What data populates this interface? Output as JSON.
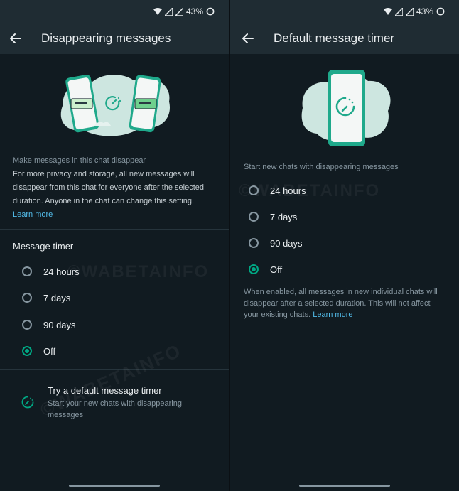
{
  "status": {
    "battery": "43%"
  },
  "colors": {
    "accent": "#00a884",
    "link": "#53bdeb",
    "surface": "#1f2c33",
    "background": "#111b21"
  },
  "left": {
    "title": "Disappearing messages",
    "intro_heading": "Make messages in this chat disappear",
    "intro_lines": [
      "For more privacy and storage, all new messages will",
      "disappear from this chat for everyone after the selected",
      "duration. Anyone in the chat can change this setting."
    ],
    "learn_more": "Learn more",
    "timer_title": "Message timer",
    "options": [
      "24 hours",
      "7 days",
      "90 days",
      "Off"
    ],
    "selected_option": "Off",
    "try_title": "Try a default message timer",
    "try_subtitle_lines": [
      "Start your new chats with disappearing",
      "messages"
    ],
    "watermark": "©WABETAINFO"
  },
  "right": {
    "title": "Default message timer",
    "heading": "Start new chats with disappearing messages",
    "options": [
      "24 hours",
      "7 days",
      "90 days",
      "Off"
    ],
    "selected_option": "Off",
    "footer_lines": [
      "When enabled, all messages in new individual chats will",
      "disappear after a selected duration. This will not affect"
    ],
    "footer_last": "your existing chats.",
    "learn_more": "Learn more",
    "watermark": "©WABETAINFO"
  }
}
